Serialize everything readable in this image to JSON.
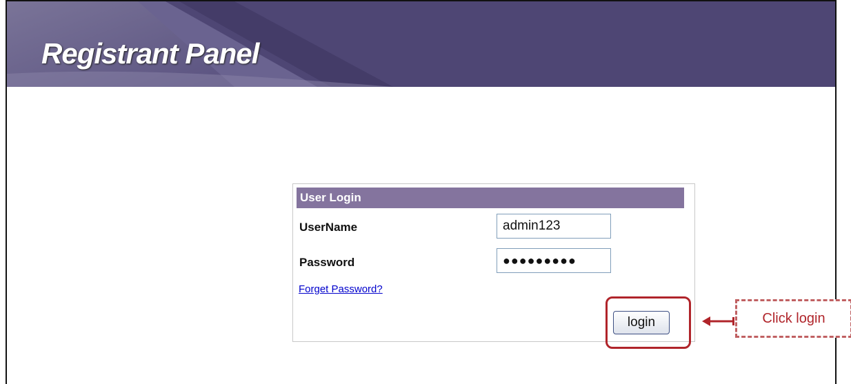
{
  "banner": {
    "title": "Registrant Panel"
  },
  "login": {
    "header": "User Login",
    "username_label": "UserName",
    "username_value": "admin123",
    "password_label": "Password",
    "password_display": "●●●●●●●●●",
    "forgot_link": "Forget Password?",
    "login_button": "login"
  },
  "annotation": {
    "callout_text": "Click login",
    "color": "#b0242a"
  },
  "colors": {
    "banner_bg": "#4e4674",
    "header_bg": "#84749e"
  }
}
